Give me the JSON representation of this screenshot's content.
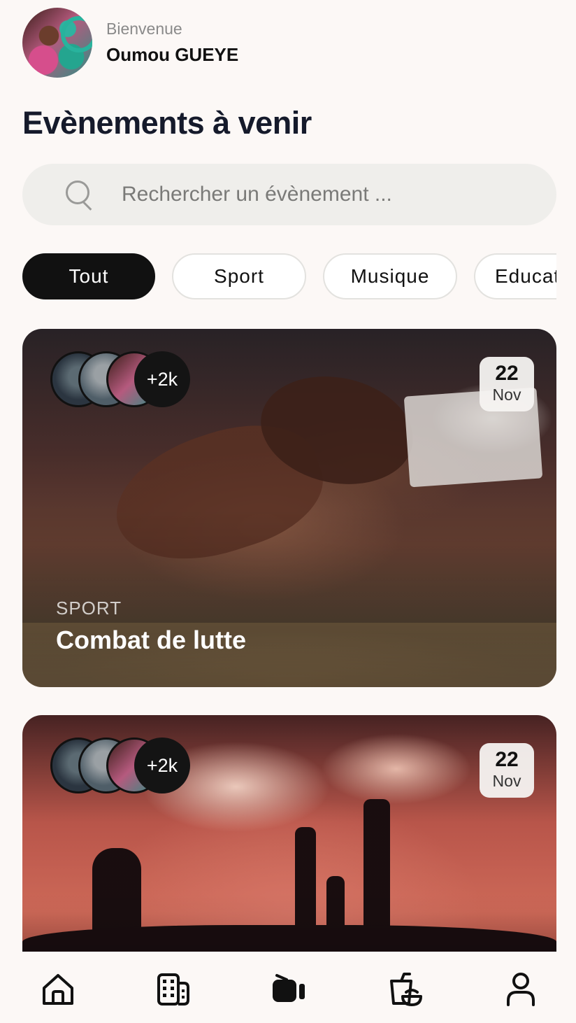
{
  "header": {
    "greeting": "Bienvenue",
    "username": "Oumou GUEYE"
  },
  "page_title": "Evènements à venir",
  "search": {
    "placeholder": "Rechercher un évènement ...",
    "value": ""
  },
  "filters": [
    {
      "label": "Tout",
      "active": true
    },
    {
      "label": "Sport",
      "active": false
    },
    {
      "label": "Musique",
      "active": false
    },
    {
      "label": "Educat",
      "active": false
    }
  ],
  "events": [
    {
      "attendees_more": "+2k",
      "date_day": "22",
      "date_month": "Nov",
      "category": "SPORT",
      "title": "Combat de lutte"
    },
    {
      "attendees_more": "+2k",
      "date_day": "22",
      "date_month": "Nov"
    }
  ],
  "nav": {
    "items": [
      "home-icon",
      "building-icon",
      "video-icon",
      "food-icon",
      "profile-icon"
    ]
  },
  "colors": {
    "background": "#fcf8f6",
    "active_chip": "#111111",
    "title": "#151a2b"
  }
}
